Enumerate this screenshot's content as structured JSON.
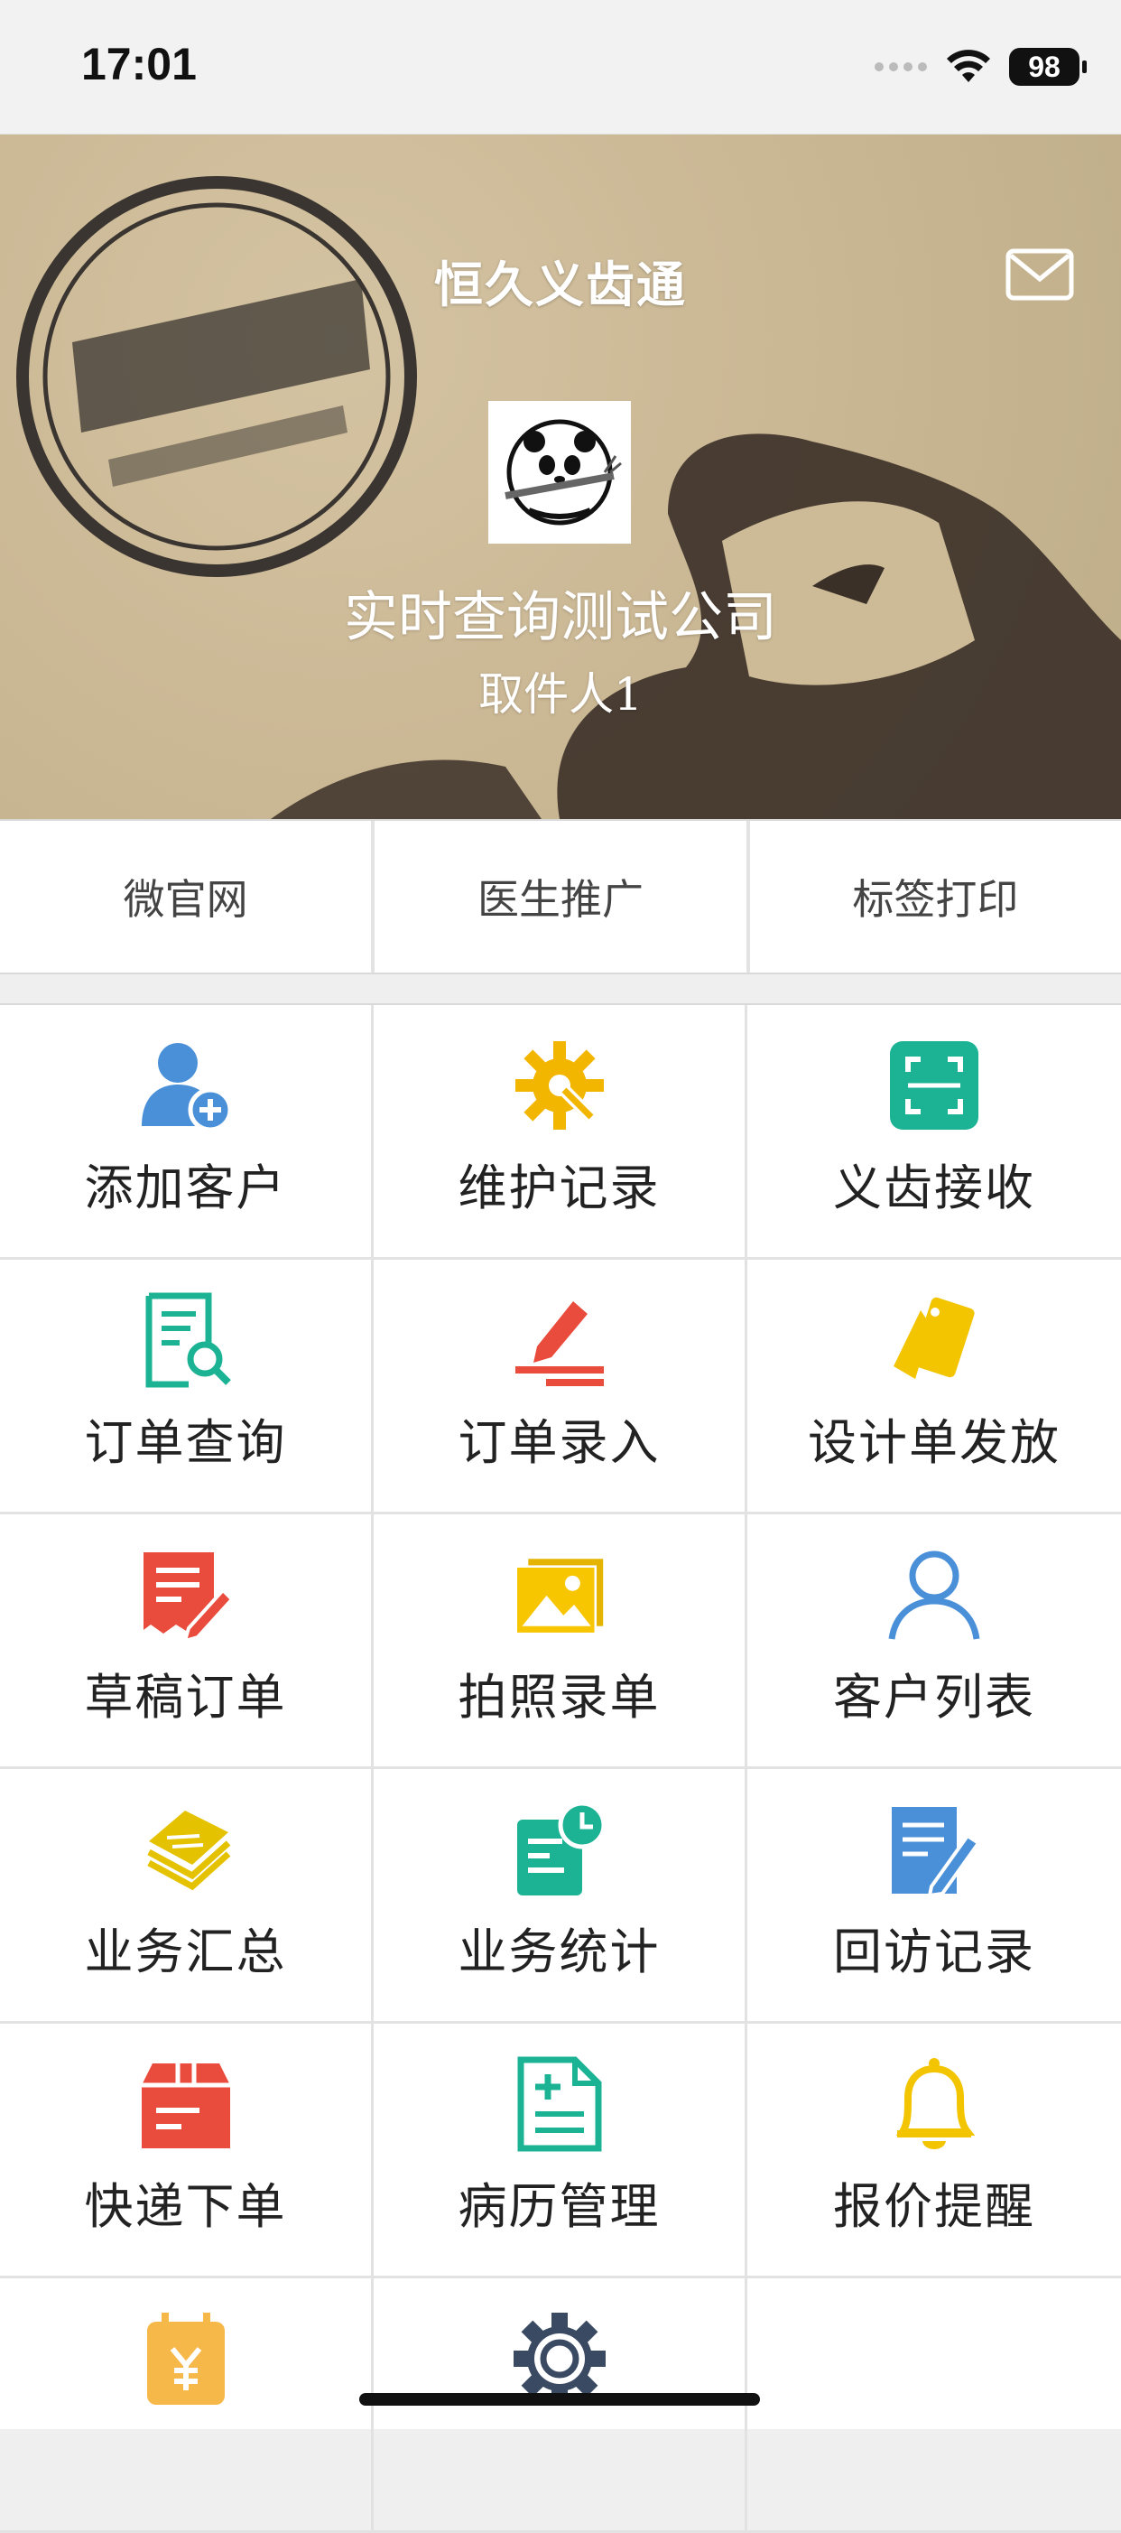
{
  "status_bar": {
    "time": "17:01",
    "battery": "98"
  },
  "header": {
    "title": "恒久义齿通",
    "company": "实时查询测试公司",
    "user": "取件人1"
  },
  "quick_links": [
    "微官网",
    "医生推广",
    "标签打印"
  ],
  "grid": [
    {
      "label": "添加客户",
      "icon": "add-user-icon",
      "color": "#4a90d9"
    },
    {
      "label": "维护记录",
      "icon": "gear-wrench-icon",
      "color": "#f2b600"
    },
    {
      "label": "义齿接收",
      "icon": "scan-icon",
      "color": "#1bb394"
    },
    {
      "label": "订单查询",
      "icon": "document-search-icon",
      "color": "#1bb394"
    },
    {
      "label": "订单录入",
      "icon": "pencil-icon",
      "color": "#e94b3c"
    },
    {
      "label": "设计单发放",
      "icon": "tag-icon",
      "color": "#f2c500"
    },
    {
      "label": "草稿订单",
      "icon": "draft-edit-icon",
      "color": "#e94b3c"
    },
    {
      "label": "拍照录单",
      "icon": "photo-icon",
      "color": "#f2c500"
    },
    {
      "label": "客户列表",
      "icon": "person-icon",
      "color": "#4a90d9"
    },
    {
      "label": "业务汇总",
      "icon": "stack-icon",
      "color": "#e5c200"
    },
    {
      "label": "业务统计",
      "icon": "stats-clock-icon",
      "color": "#1bb394"
    },
    {
      "label": "回访记录",
      "icon": "note-edit-icon",
      "color": "#4a90d9"
    },
    {
      "label": "快递下单",
      "icon": "package-icon",
      "color": "#e94b3c"
    },
    {
      "label": "病历管理",
      "icon": "medical-record-icon",
      "color": "#1bb394"
    },
    {
      "label": "报价提醒",
      "icon": "bell-icon",
      "color": "#f2c500"
    },
    {
      "label": "",
      "icon": "yen-calendar-icon",
      "color": "#f7b84a"
    },
    {
      "label": "",
      "icon": "settings-icon",
      "color": "#3b4a63"
    }
  ]
}
